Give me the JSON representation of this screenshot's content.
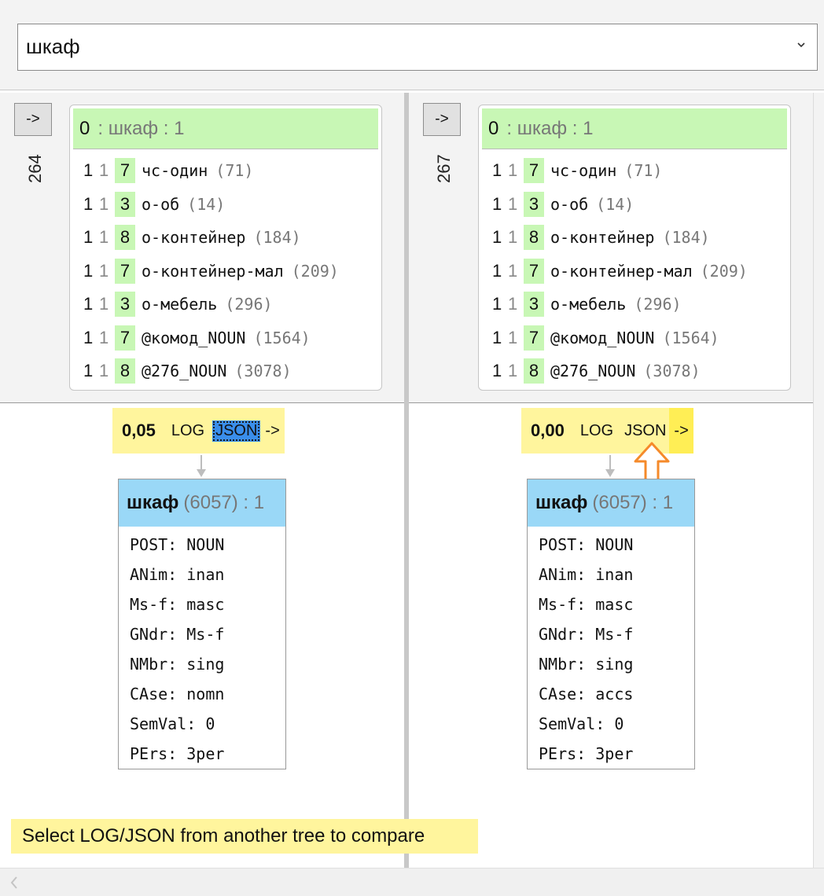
{
  "search": {
    "value": "шкаф",
    "chevron_icon": "chevron-down-icon"
  },
  "panels": [
    {
      "nav_label": "->",
      "tree_id": "264",
      "card": {
        "head_num": "0",
        "head_rest": ": шкаф  : 1",
        "rows": [
          {
            "n1": "1",
            "n2": "1",
            "badge": "7",
            "label": "чс-один",
            "count": "(71)"
          },
          {
            "n1": "1",
            "n2": "1",
            "badge": "3",
            "label": "о-об",
            "count": "(14)"
          },
          {
            "n1": "1",
            "n2": "1",
            "badge": "8",
            "label": "о-контейнер",
            "count": "(184)"
          },
          {
            "n1": "1",
            "n2": "1",
            "badge": "7",
            "label": "о-контейнер-мал",
            "count": "(209)"
          },
          {
            "n1": "1",
            "n2": "1",
            "badge": "3",
            "label": "о-мебель",
            "count": "(296)"
          },
          {
            "n1": "1",
            "n2": "1",
            "badge": "7",
            "label": "@комод_NOUN",
            "count": "(1564)"
          },
          {
            "n1": "1",
            "n2": "1",
            "badge": "8",
            "label": "@276_NOUN",
            "count": "(3078)"
          }
        ]
      },
      "score": {
        "value": "0,05",
        "log": "LOG",
        "json": "JSON",
        "arrow": "->"
      },
      "node": {
        "word": "шкаф",
        "rest": "(6057) : 1",
        "features": [
          "POST: NOUN",
          "ANim: inan",
          "Ms-f: masc",
          "GNdr: Ms-f",
          "NMbr: sing",
          "CAse: nomn",
          "SemVal: 0",
          "PErs: 3per"
        ]
      }
    },
    {
      "nav_label": "->",
      "tree_id": "267",
      "card": {
        "head_num": "0",
        "head_rest": ": шкаф  : 1",
        "rows": [
          {
            "n1": "1",
            "n2": "1",
            "badge": "7",
            "label": "чс-один",
            "count": "(71)"
          },
          {
            "n1": "1",
            "n2": "1",
            "badge": "3",
            "label": "о-об",
            "count": "(14)"
          },
          {
            "n1": "1",
            "n2": "1",
            "badge": "8",
            "label": "о-контейнер",
            "count": "(184)"
          },
          {
            "n1": "1",
            "n2": "1",
            "badge": "7",
            "label": "о-контейнер-мал",
            "count": "(209)"
          },
          {
            "n1": "1",
            "n2": "1",
            "badge": "3",
            "label": "о-мебель",
            "count": "(296)"
          },
          {
            "n1": "1",
            "n2": "1",
            "badge": "7",
            "label": "@комод_NOUN",
            "count": "(1564)"
          },
          {
            "n1": "1",
            "n2": "1",
            "badge": "8",
            "label": "@276_NOUN",
            "count": "(3078)"
          }
        ]
      },
      "score": {
        "value": "0,00",
        "log": "LOG",
        "json": "JSON",
        "arrow": "->"
      },
      "node": {
        "word": "шкаф",
        "rest": "(6057) : 1",
        "features": [
          "POST: NOUN",
          "ANim: inan",
          "Ms-f: masc",
          "GNdr: Ms-f",
          "NMbr: sing",
          "CAse: accs",
          "SemVal: 0",
          "PErs: 3per"
        ]
      }
    }
  ],
  "hint": "Select LOG/JSON from another tree to compare",
  "colors": {
    "header_green": "#c8f7b5",
    "node_blue": "#9ad8f7",
    "score_yellow": "#fff59d",
    "selection_blue": "#3a8eea",
    "pointer_orange": "#f58a2a"
  },
  "icons": {
    "up_arrow": "up-arrow-icon",
    "scroll_left": "chevron-left-icon"
  }
}
